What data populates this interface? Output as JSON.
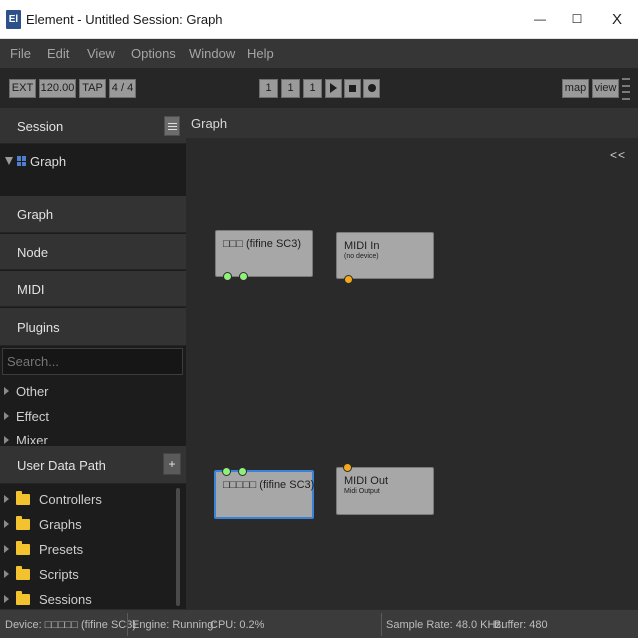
{
  "window": {
    "app_logo": "El",
    "title": "Element - Untitled Session: Graph",
    "min_glyph": "—",
    "max_glyph": "☐",
    "close_glyph": "X"
  },
  "menu": [
    "File",
    "Edit",
    "View",
    "Options",
    "Window",
    "Help"
  ],
  "toolbar": {
    "ext": "EXT",
    "tempo": "120.00",
    "tap": "TAP",
    "meter": "4 / 4",
    "bar": "1",
    "beat": "1",
    "sub": "1",
    "map": "map",
    "view": "view"
  },
  "sidebar": {
    "session_label": "Session",
    "tree_graph_label": "Graph",
    "panels": [
      "Graph",
      "Node",
      "MIDI",
      "Plugins"
    ],
    "search_placeholder": "Search...",
    "categories": [
      "Other",
      "Effect",
      "Mixer"
    ],
    "user_data_path_label": "User Data Path",
    "add_symbol": "+",
    "folders": [
      "Controllers",
      "Graphs",
      "Presets",
      "Scripts",
      "Sessions"
    ]
  },
  "graph": {
    "title": "Graph",
    "collapse": "<<",
    "nodes": [
      {
        "name": "□□□ (fifine SC3)",
        "subtitle": ""
      },
      {
        "name": "MIDI In",
        "subtitle": "(no device)"
      },
      {
        "name": "□□□□□ (fifine SC3)",
        "subtitle": ""
      },
      {
        "name": "MIDI Out",
        "subtitle": "Midi Output"
      }
    ]
  },
  "status": {
    "device": "Device: □□□□□ (fifine SC3)",
    "engine": "Engine: Running:",
    "cpu": "CPU: 0.2%",
    "sample_rate": "Sample Rate: 48.0 KHz:",
    "buffer": "Buffer: 480"
  },
  "colors": {
    "selection": "#3a82d8",
    "audio_port": "#8ff07a",
    "midi_port": "#f6a918",
    "folder": "#f3c32f",
    "logo": "#2d4f8a"
  }
}
